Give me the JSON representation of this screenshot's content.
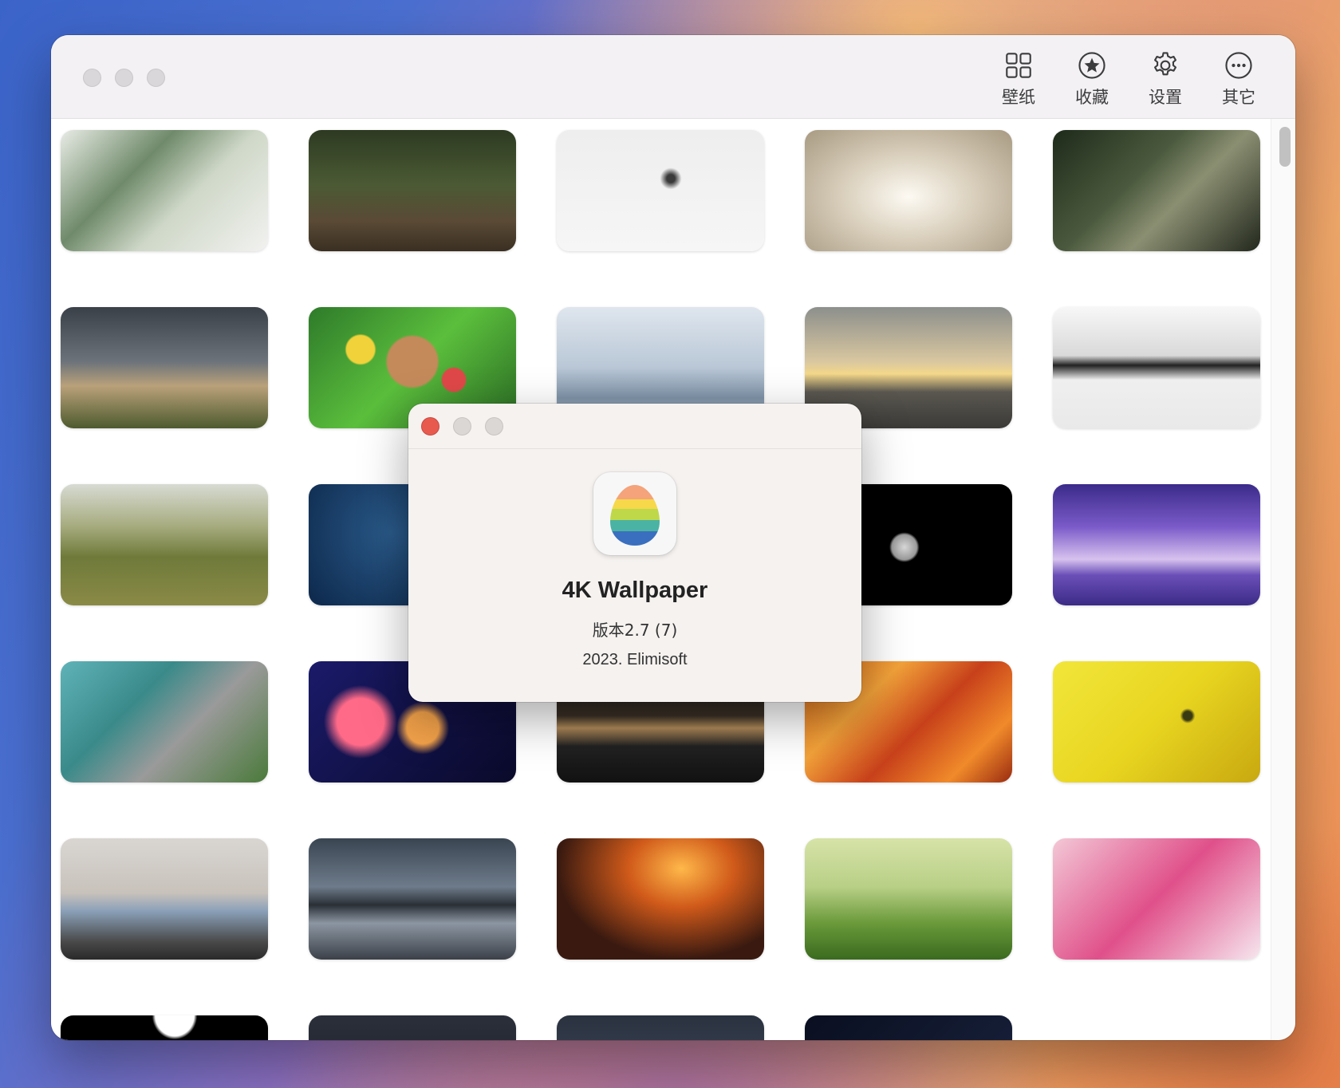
{
  "toolbar": {
    "wallpaper": "壁纸",
    "favorites": "收藏",
    "settings": "设置",
    "other": "其它"
  },
  "grid": {
    "thumbnails": [
      {
        "name": "bird-on-leaves",
        "bg": "linear-gradient(135deg,#e9ece6 0%,#6f8a6a 35%,#cfd8c8 60%,#f2f2f0 100%)"
      },
      {
        "name": "deer-in-forest",
        "bg": "linear-gradient(180deg,#2d3a22 0%,#4b5a34 45%,#5a4a36 75%,#3a2f22 100%)"
      },
      {
        "name": "lone-tree-snow",
        "bg": "radial-gradient(circle at 55% 40%,#3a3a3a 0,#3a3a3a 3%,transparent 8%),linear-gradient(180deg,#eeeeee,#f6f6f6)"
      },
      {
        "name": "swans-heart",
        "bg": "radial-gradient(ellipse at 50% 55%,#fdfaf3 0%,#d9cfbc 45%,#a89a82 100%)"
      },
      {
        "name": "lizard-on-rock",
        "bg": "linear-gradient(135deg,#1e2a1a 0%,#4b5a3e 40%,#8b8f72 60%,#22281d 100%)"
      },
      {
        "name": "armored-vehicle",
        "bg": "linear-gradient(180deg,#3a4048 0%,#6c737a 45%,#b9a17a 65%,#4e5a2e 100%)"
      },
      {
        "name": "dog-easter-eggs",
        "bg": "radial-gradient(circle at 25% 35%,#f1d23a 0,#f1d23a 8%,transparent 9%),radial-gradient(circle at 70% 60%,#e04848 0,#e04848 7%,transparent 8%),radial-gradient(circle at 50% 45%,#c48a5a 0,#c48a5a 20%,transparent 22%),linear-gradient(135deg,#2e7a2a,#5bbf3c,#2a6a24)"
      },
      {
        "name": "misty-mountains",
        "bg": "linear-gradient(180deg,#dfe6ee 0%,#b9c7d6 50%,#7f93a8 75%,#c8d3de 100%)"
      },
      {
        "name": "red-car-sunset",
        "bg": "linear-gradient(180deg,#8c8f8c 0%,#d9c7a0 45%,#f4d88a 55%,#5a5750 70%,#3b3a37 100%)"
      },
      {
        "name": "dog-in-teepee",
        "bg": "linear-gradient(180deg,#f7f7f7 0%,#d9d9d9 40%,#222 48%,#efefef 60%,#e9e9e9 100%)"
      },
      {
        "name": "seal-on-grass",
        "bg": "linear-gradient(180deg,#d7dbd3 0%,#a6ab7e 35%,#6f7a3a 60%,#8a8a46 100%)"
      },
      {
        "name": "water-drops-blue",
        "bg": "radial-gradient(circle at 40% 40%,#2a5a8a,#0f2c50 70%)"
      },
      {
        "name": "snowy-forest",
        "bg": "linear-gradient(180deg,#e6e8ec 0%,#dcdfe6 60%,#3a4a3a 72%,#f4f5f7 80%,#ffffff 100%)"
      },
      {
        "name": "moon-night",
        "bg": "radial-gradient(circle at 48% 52%,#d9d9d9 0,#9a9a9a 10%,#000 12%),#000"
      },
      {
        "name": "purple-lake",
        "bg": "linear-gradient(180deg,#3b2b8a 0%,#7a5ac8 35%,#d7c2ee 62%,#6b4fb8 75%,#3b2b86 100%)"
      },
      {
        "name": "lagoon-aerial",
        "bg": "linear-gradient(135deg,#5fb3b8 0%,#3a8a8a 35%,#9a9a9a 60%,#4a7a3a 100%)"
      },
      {
        "name": "bokeh-lights",
        "bg": "radial-gradient(circle at 25% 50%,#ff6a88 0,#ff6a88 14%,transparent 22%),radial-gradient(circle at 55% 55%,#f3a24a 0,#f3a24a 12%,transparent 20%),linear-gradient(135deg,#1a1a6a,#0a0a2a)"
      },
      {
        "name": "girl-dark-city",
        "bg": "linear-gradient(180deg,#111 0%,#3a3026 45%,#b08a5a 55%,#222 70%,#111 100%)"
      },
      {
        "name": "orange-abstract-paint",
        "bg": "linear-gradient(135deg,#e06a1a 0%,#f2a23a 30%,#c7401a 55%,#f08a2a 80%,#9a2a10 100%)"
      },
      {
        "name": "yellow-bubbles",
        "bg": "radial-gradient(circle at 65% 45%,#3a3a12 0,#3a3a12 3%,transparent 5%),linear-gradient(135deg,#f2e63a,#e8d520 50%,#c8a810)"
      },
      {
        "name": "suv-on-street",
        "bg": "linear-gradient(180deg,#d9d6d2 0%,#c8c2bb 45%,#8aa0b8 60%,#4a4a4a 85%,#2a2a2a 100%)"
      },
      {
        "name": "sea-rock-long-exposure",
        "bg": "linear-gradient(180deg,#3a4552 0%,#6e7b8a 40%,#2a2f36 55%,#8c96a2 70%,#3b4048 100%)"
      },
      {
        "name": "jet-at-sunset",
        "bg": "radial-gradient(ellipse at 60% 25%,#ffb84a 0%,#d05a1a 30%,#3a1a10 70%),#2a1208"
      },
      {
        "name": "wildflower-meadow",
        "bg": "linear-gradient(180deg,#d7e3a8 0%,#b8cf86 40%,#6a9a3a 70%,#3a6a1e 100%)"
      },
      {
        "name": "pink-flowers",
        "bg": "linear-gradient(135deg,#f3c8d6,#e0508a,#f6e7ee)"
      },
      {
        "name": "dark-abstract",
        "bg": "radial-gradient(ellipse at 55% 0%,#ffffff 0,#ffffff 12%,#000 14%),#000"
      },
      {
        "name": "dark-flowers",
        "bg": "linear-gradient(180deg,#2a2f3a,#1a1a20)"
      },
      {
        "name": "aerial-city",
        "bg": "linear-gradient(180deg,#2a3240,#4a5566)"
      },
      {
        "name": "starry-rain",
        "bg": "linear-gradient(135deg,#0a0f20,#1a2440)"
      }
    ]
  },
  "about": {
    "app_name": "4K Wallpaper",
    "version": "版本2.7 (7)",
    "copyright": "2023. Elimisoft",
    "close_color": "#e95a4e",
    "inactive_color": "#dad7d5"
  }
}
